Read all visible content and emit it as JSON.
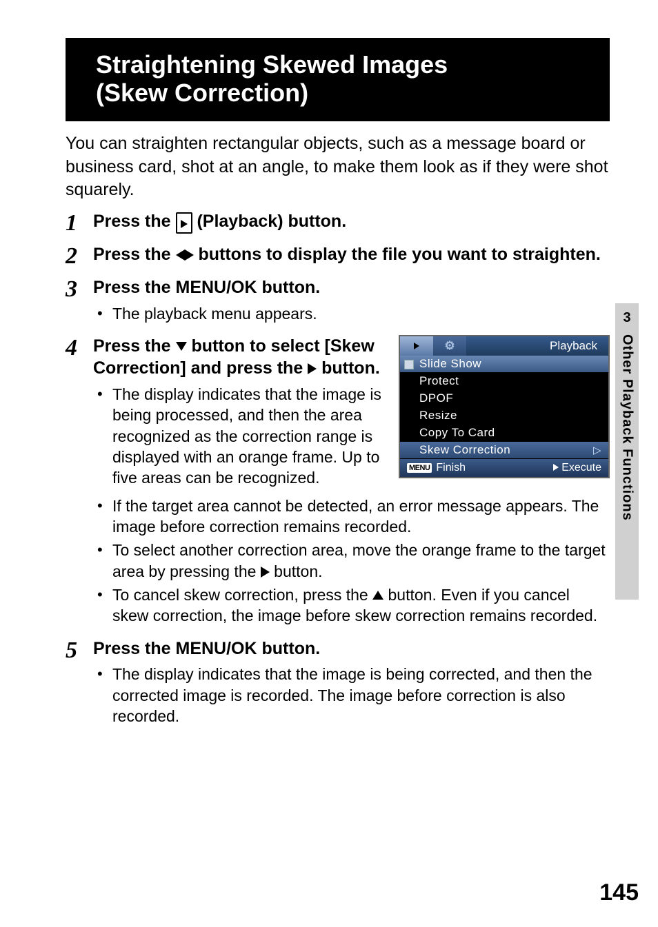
{
  "header": {
    "title_line1": "Straightening Skewed Images",
    "title_line2": "(Skew Correction)"
  },
  "intro": "You can straighten rectangular objects, such as a message board or business card, shot at an angle, to make them look as if they were shot squarely.",
  "steps": {
    "s1": {
      "num": "1",
      "title_a": "Press the ",
      "title_b": " (Playback) button."
    },
    "s2": {
      "num": "2",
      "title_a": "Press the ",
      "title_b": " buttons to display the file you want to straighten."
    },
    "s3": {
      "num": "3",
      "title": "Press the MENU/OK button.",
      "b1": "The playback menu appears."
    },
    "s4": {
      "num": "4",
      "title_a": "Press the ",
      "title_b": " button to select [Skew Correction] and press the ",
      "title_c": " button.",
      "b1": "The display indicates that the image is being processed, and then the area recognized as the correction range is displayed with an orange frame. Up to five areas can be recognized.",
      "b2": "If the target area cannot be detected, an error message appears. The image before correction remains recorded.",
      "b3a": "To select another correction area, move the orange frame to the target area by pressing the ",
      "b3b": " button.",
      "b4a": "To cancel skew correction, press the ",
      "b4b": " button. Even if you cancel skew correction, the image before skew correction remains recorded."
    },
    "s5": {
      "num": "5",
      "title": "Press the MENU/OK button.",
      "b1": "The display indicates that the image is being corrected, and then the corrected image is recorded. The image before correction is also recorded."
    }
  },
  "lcd": {
    "top_label": "Playback",
    "items": [
      "Slide Show",
      "Protect",
      "DPOF",
      "Resize",
      "Copy To Card",
      "Skew Correction"
    ],
    "menu_badge": "MENU",
    "finish": "Finish",
    "execute": "Execute"
  },
  "sidebar": {
    "chapter": "3",
    "label": "Other Playback Functions"
  },
  "page_number": "145"
}
